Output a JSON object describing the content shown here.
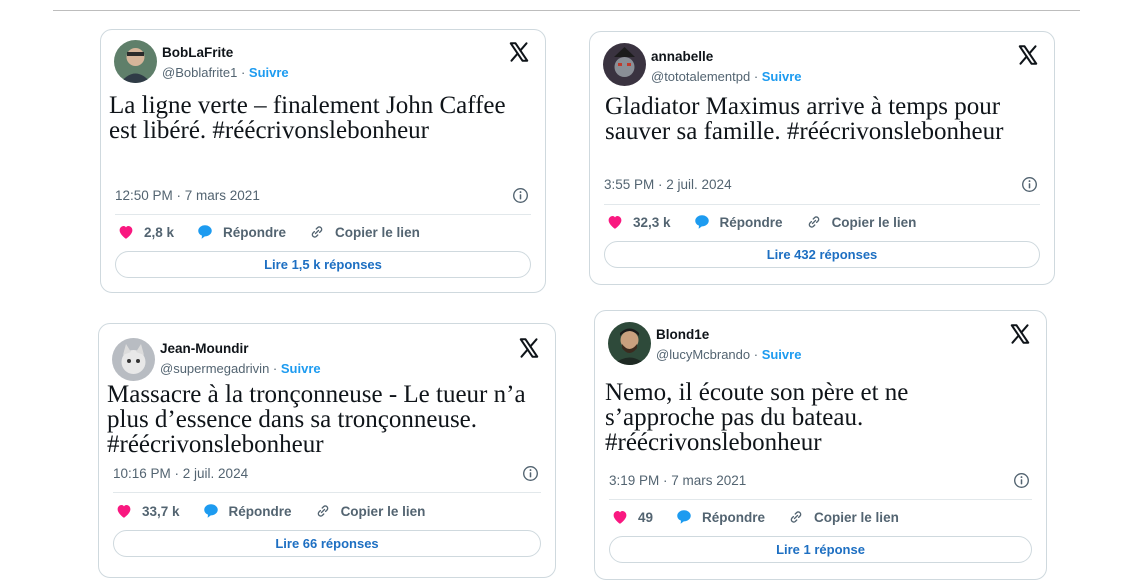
{
  "colors": {
    "accent": "#1d9bf0",
    "like": "#f91880",
    "reply": "#1d9bf0",
    "muted": "#536471",
    "border": "#cfd9de"
  },
  "icons": {
    "brand": "x-logo-icon",
    "info": "info-icon",
    "like": "heart-icon",
    "reply": "speech-bubble-icon",
    "copy": "link-icon"
  },
  "tweets": [
    {
      "name": "BobLaFrite",
      "handle": "@Boblafrite1",
      "separator": " · ",
      "follow": "Suivre",
      "text": "La ligne verte – finalement John Caffee est libéré. #réécrivonslebonheur",
      "timestamp": "12:50 PM · 7 mars 2021",
      "likes": "2,8 k",
      "reply": "Répondre",
      "copy": "Copier le lien",
      "read": "Lire 1,5 k réponses"
    },
    {
      "name": "annabelle",
      "handle": "@tototalementpd",
      "separator": " · ",
      "follow": "Suivre",
      "text": "Gladiator Maximus arrive à temps pour sauver sa famille. #réécrivonslebonheur",
      "timestamp": "3:55 PM · 2 juil. 2024",
      "likes": "32,3 k",
      "reply": "Répondre",
      "copy": "Copier le lien",
      "read": "Lire 432 réponses"
    },
    {
      "name": "Jean-Moundir",
      "handle": "@supermegadrivin",
      "separator": " · ",
      "follow": "Suivre",
      "text": "Massacre à la tronçonneuse -  Le tueur n’a plus d’essence dans sa tronçonneuse. #réécrivonslebonheur",
      "timestamp": "10:16 PM · 2 juil. 2024",
      "likes": "33,7 k",
      "reply": "Répondre",
      "copy": "Copier le lien",
      "read": "Lire 66 réponses"
    },
    {
      "name": "Blond1e",
      "handle": "@lucyMcbrando",
      "separator": " · ",
      "follow": "Suivre",
      "text": "Nemo, il écoute son père et ne s’approche pas du bateau. #réécrivonslebonheur",
      "timestamp": "3:19 PM · 7 mars 2021",
      "likes": "49",
      "reply": "Répondre",
      "copy": "Copier le lien",
      "read": "Lire 1 réponse"
    }
  ]
}
